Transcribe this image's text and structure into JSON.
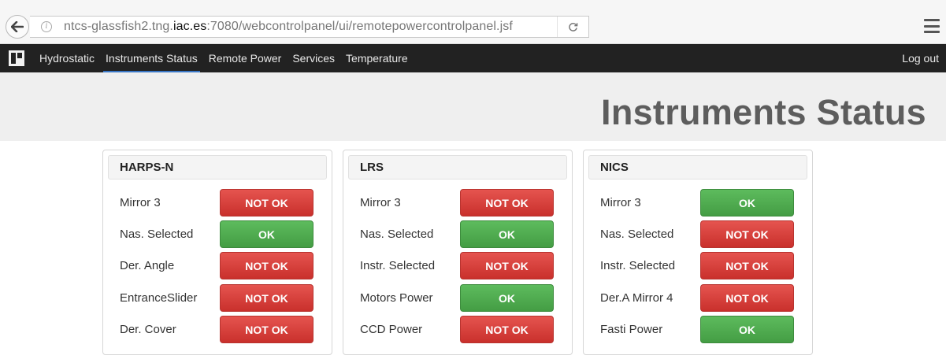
{
  "browser": {
    "url_prefix": "ntcs-glassfish2.tng.",
    "url_host": "iac.es",
    "url_suffix": ":7080/webcontrolpanel/ui/remotepowercontrolpanel.jsf"
  },
  "navbar": {
    "items": [
      {
        "label": "Hydrostatic",
        "active": false
      },
      {
        "label": "Instruments Status",
        "active": true
      },
      {
        "label": "Remote Power",
        "active": false
      },
      {
        "label": "Services",
        "active": false
      },
      {
        "label": "Temperature",
        "active": false
      }
    ],
    "logout_label": "Log out"
  },
  "page": {
    "title": "Instruments Status"
  },
  "colors": {
    "ok": "#5cb85c",
    "not_ok": "#d9534f",
    "navbar": "#222222",
    "active_underline": "#3a77c6"
  },
  "panels": [
    {
      "title": "HARPS-N",
      "rows": [
        {
          "label": "Mirror 3",
          "status": "NOT OK"
        },
        {
          "label": "Nas. Selected",
          "status": "OK"
        },
        {
          "label": "Der. Angle",
          "status": "NOT OK"
        },
        {
          "label": "EntranceSlider",
          "status": "NOT OK"
        },
        {
          "label": "Der. Cover",
          "status": "NOT OK"
        }
      ]
    },
    {
      "title": "LRS",
      "rows": [
        {
          "label": "Mirror 3",
          "status": "NOT OK"
        },
        {
          "label": "Nas. Selected",
          "status": "OK"
        },
        {
          "label": "Instr. Selected",
          "status": "NOT OK"
        },
        {
          "label": "Motors Power",
          "status": "OK"
        },
        {
          "label": "CCD Power",
          "status": "NOT OK"
        }
      ]
    },
    {
      "title": "NICS",
      "rows": [
        {
          "label": "Mirror 3",
          "status": "OK"
        },
        {
          "label": "Nas. Selected",
          "status": "NOT OK"
        },
        {
          "label": "Instr. Selected",
          "status": "NOT OK"
        },
        {
          "label": "Der.A Mirror 4",
          "status": "NOT OK"
        },
        {
          "label": "Fasti Power",
          "status": "OK"
        }
      ]
    }
  ]
}
